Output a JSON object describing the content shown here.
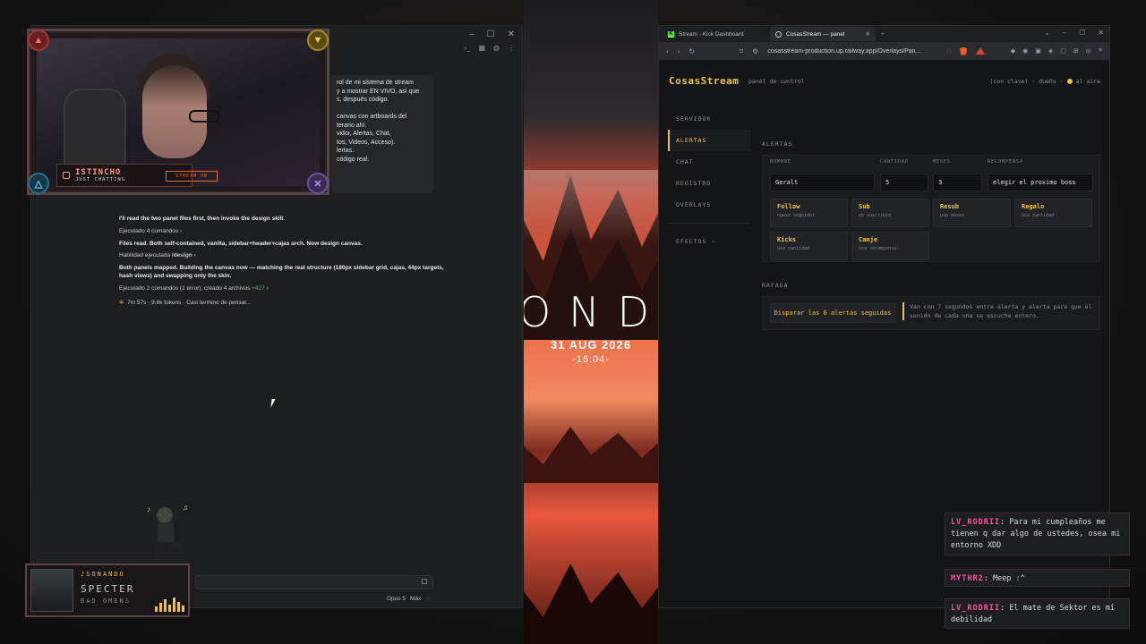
{
  "left_window": {
    "message_lines": [
      "rol de mi sistema de stream",
      "y a mostrar EN VIVO, así que",
      "s, después código.",
      "",
      "canvas con artboards del",
      "terario ahí.",
      "vidor, Alertas, Chat,",
      "tos, Videos, Acceso).",
      "lertas.",
      "código real."
    ],
    "log": {
      "l1": "I'll read the two panel files first, then invoke the design skill.",
      "l2": "Ejecutado 4 comandos",
      "l3": "Files read. Both self-contained, vanilla, sidebar+header+cajas arch. Now design canvas.",
      "l4_prefix": "Habilidad ejecutada ",
      "l4_skill": "/design",
      "l5": "Both panels mapped. Building the canvas now — matching the real structure (180px sidebar grid, cajas, 44px targets,",
      "l6": "hash views) and swapping only the skin.",
      "l7_prefix": "Ejecutado 2 comandos (1 error), creado 4 archivos ",
      "l7_delta": "+427",
      "l8": "7m 57s · 9.6k tokens · Casi termino de pensar..."
    },
    "model": "Opus 5",
    "effort": "Máx"
  },
  "webcam": {
    "name": "ISTINCHO",
    "category": "JUST CHATTING",
    "badge": "STREAM ON"
  },
  "poster": {
    "big_text": "ONDA",
    "date": "31 AUG 2026",
    "time": "-16:04-"
  },
  "browser": {
    "tabs": [
      {
        "label": "Stream - Kick Dashboard"
      },
      {
        "label": "CosasStream — panel"
      }
    ],
    "url": "cosasstream-production.up.railway.app/Overlays/Pan..."
  },
  "panel": {
    "brand": "CosasStream",
    "brand_sub": "panel de control",
    "status_text": "(con clave) · dueño ·",
    "status_live": "al aire",
    "nav": [
      "SERVIDOR",
      "ALERTAS",
      "CHAT",
      "REGISTRO",
      "OVERLAYS",
      "EFECTOS"
    ],
    "alerts": {
      "section": "ALERTAS",
      "labels": {
        "name": "NOMBRE",
        "qty": "CANTIDAD",
        "months": "MESES",
        "reward": "RECOMPENSA"
      },
      "values": {
        "name": "Geralt",
        "qty": "5",
        "months": "3",
        "reward": "elegir el proximo boss"
      },
      "cards": [
        {
          "title": "Follow",
          "sub": "nuevo seguidor"
        },
        {
          "title": "Sub",
          "sub": "se suscribió"
        },
        {
          "title": "Resub",
          "sub": "usa meses"
        },
        {
          "title": "Regalo",
          "sub": "usa cantidad"
        },
        {
          "title": "Kicks",
          "sub": "usa cantidad"
        },
        {
          "title": "Canje",
          "sub": "usa recompensa"
        }
      ]
    },
    "burst": {
      "section": "RAFAGA",
      "button": "Disparar las 6 alertas seguidas",
      "note": "Van con 7 segundos entre alerta y alerta para que el sonido de cada una se escuche entero."
    }
  },
  "chat": [
    {
      "user": "LV_RODRII",
      "text": "Para mi cumpleaños me tienen q dar algo de ustedes, osea mi entorno XDD"
    },
    {
      "user": "MYTHR2",
      "text": "Meep :^"
    },
    {
      "user": "LV_RODRII",
      "text": "El mate de Sektor es mi debilidad"
    }
  ],
  "now_playing": {
    "label": "SONANDO",
    "artist": "SPECTER",
    "song": "BAD OMENS"
  }
}
